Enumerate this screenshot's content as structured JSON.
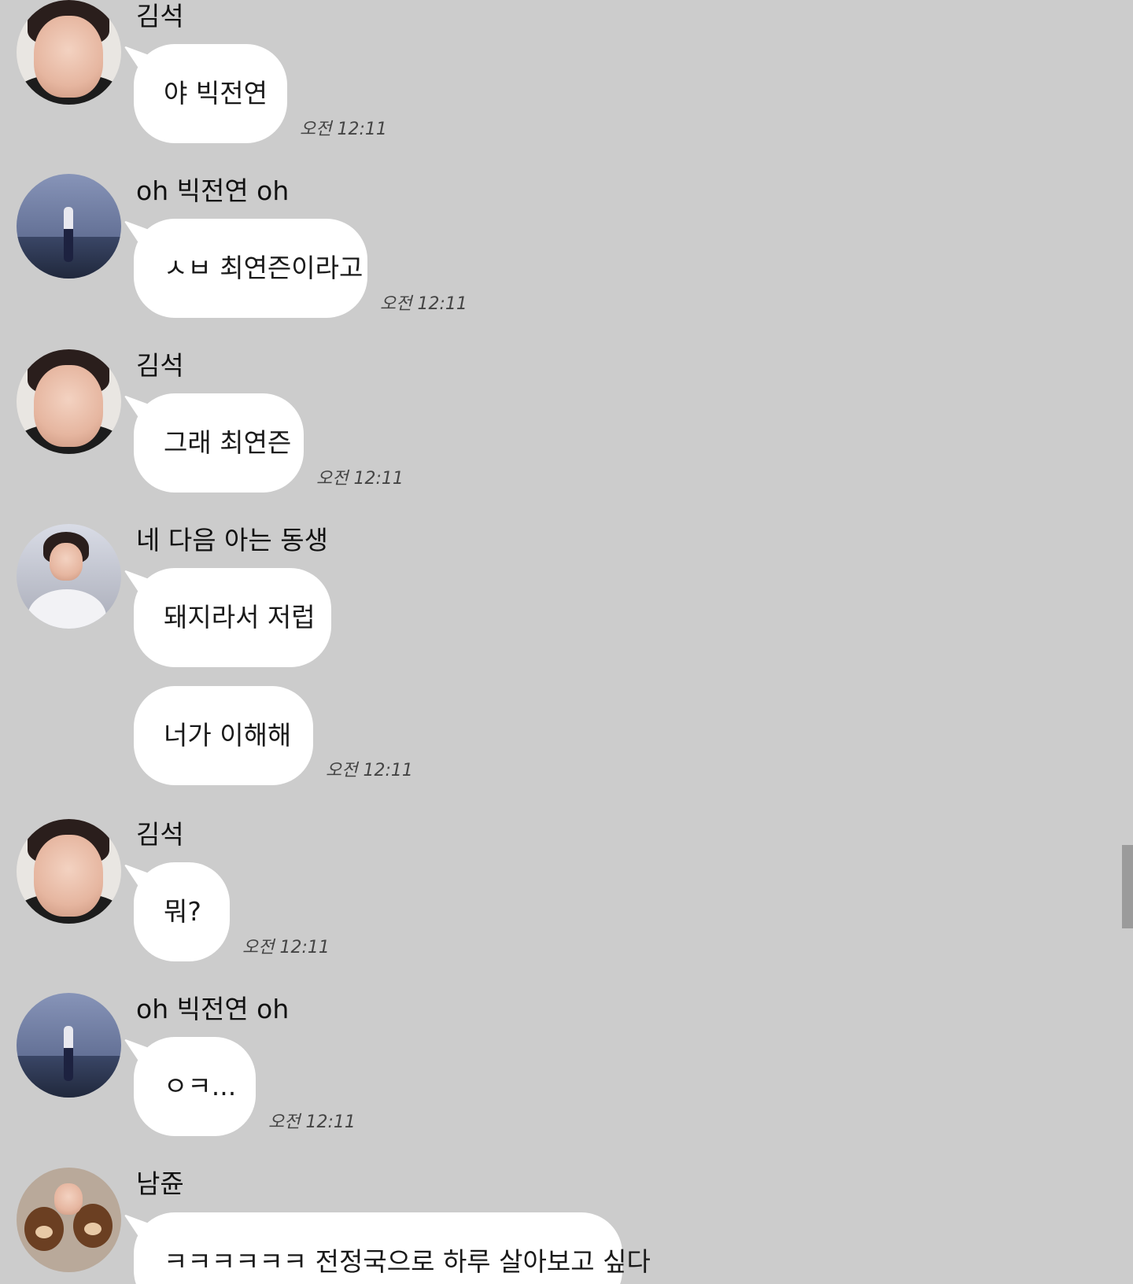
{
  "screen": {
    "background": "#cccccc",
    "bubble_color": "#ffffff"
  },
  "messages": [
    {
      "sender": "김석",
      "avatar": "avatar-seokjin-selfie",
      "bubbles": [
        "야 빅전연"
      ],
      "time": "오전 12:11"
    },
    {
      "sender": "oh 빅전연 oh",
      "avatar": "avatar-stage-photo",
      "bubbles": [
        "ㅅㅂ 최연즌이라고"
      ],
      "time": "오전 12:11"
    },
    {
      "sender": "김석",
      "avatar": "avatar-seokjin-selfie",
      "bubbles": [
        "그래 최연즌"
      ],
      "time": "오전 12:11"
    },
    {
      "sender": "네 다음 아는 동생",
      "avatar": "avatar-seated-photo",
      "bubbles": [
        "돼지라서 저럽",
        "너가 이해해"
      ],
      "time": "오전 12:11"
    },
    {
      "sender": "김석",
      "avatar": "avatar-seokjin-selfie",
      "bubbles": [
        "뭐?"
      ],
      "time": "오전 12:11"
    },
    {
      "sender": "oh 빅전연 oh",
      "avatar": "avatar-stage-photo",
      "bubbles": [
        "ㅇㅋ..."
      ],
      "time": "오전 12:11"
    },
    {
      "sender": "남쥰",
      "avatar": "avatar-bears-photo",
      "bubbles": [
        "ㅋㅋㅋㅋㅋㅋ 전정국으로 하루 살아보고 싶다"
      ],
      "time": ""
    }
  ]
}
